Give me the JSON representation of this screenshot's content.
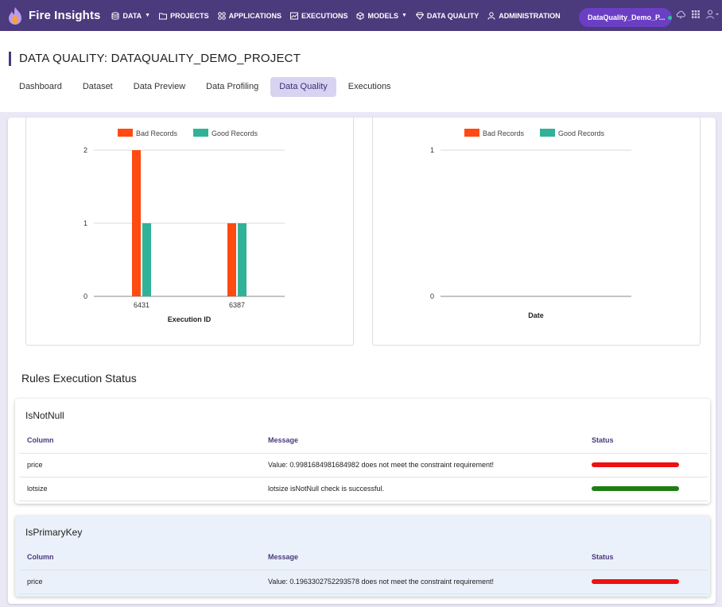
{
  "app": {
    "name": "Fire Insights"
  },
  "nav": {
    "items": [
      {
        "label": "DATA",
        "icon": "database-icon",
        "dropdown": true
      },
      {
        "label": "PROJECTS",
        "icon": "folder-icon",
        "dropdown": false
      },
      {
        "label": "APPLICATIONS",
        "icon": "apps-icon",
        "dropdown": false
      },
      {
        "label": "EXECUTIONS",
        "icon": "executions-icon",
        "dropdown": false
      },
      {
        "label": "MODELS",
        "icon": "cube-icon",
        "dropdown": true
      },
      {
        "label": "DATA QUALITY",
        "icon": "diamond-icon",
        "dropdown": false
      },
      {
        "label": "ADMINISTRATION",
        "icon": "admin-icon",
        "dropdown": false
      }
    ],
    "project": "DataQuality_Demo_P...",
    "project_status_color": "#29c79a"
  },
  "page": {
    "title": "DATA QUALITY: DATAQUALITY_DEMO_PROJECT",
    "tabs": [
      "Dashboard",
      "Dataset",
      "Data Preview",
      "Data Profiling",
      "Data Quality",
      "Executions"
    ],
    "active_tab": "Data Quality"
  },
  "chart_data": [
    {
      "type": "bar",
      "categories": [
        "6431",
        "6387"
      ],
      "series": [
        {
          "name": "Bad Records",
          "values": [
            2,
            1
          ],
          "color": "#ff4a12"
        },
        {
          "name": "Good Records",
          "values": [
            1,
            1
          ],
          "color": "#31b298"
        }
      ],
      "xlabel": "Execution ID",
      "ylabel": "",
      "ylim": [
        0,
        2
      ],
      "yticks": [
        "0",
        "1",
        "2"
      ],
      "grid": true,
      "legend": "top-center"
    },
    {
      "type": "bar",
      "categories": [],
      "series": [
        {
          "name": "Bad Records",
          "values": [],
          "color": "#ff4a12"
        },
        {
          "name": "Good Records",
          "values": [],
          "color": "#31b298"
        }
      ],
      "xlabel": "Date",
      "ylabel": "",
      "ylim": [
        0,
        1
      ],
      "yticks": [
        "0",
        "1"
      ],
      "grid": true,
      "legend": "top-center"
    }
  ],
  "rules": {
    "title": "Rules Execution Status",
    "columns": [
      "Column",
      "Message",
      "Status"
    ],
    "status_colors": {
      "fail": "#ee1111",
      "pass": "#1e7d12"
    },
    "cards": [
      {
        "name": "IsNotNull",
        "rows": [
          {
            "column": "price",
            "message": "Value: 0.9981684981684982 does not meet the constraint requirement!",
            "status": "fail"
          },
          {
            "column": "lotsize",
            "message": "lotsize isNotNull check is successful.",
            "status": "pass"
          }
        ]
      },
      {
        "name": "IsPrimaryKey",
        "rows": [
          {
            "column": "price",
            "message": "Value: 0.1963302752293578 does not meet the constraint requirement!",
            "status": "fail"
          }
        ]
      }
    ]
  }
}
